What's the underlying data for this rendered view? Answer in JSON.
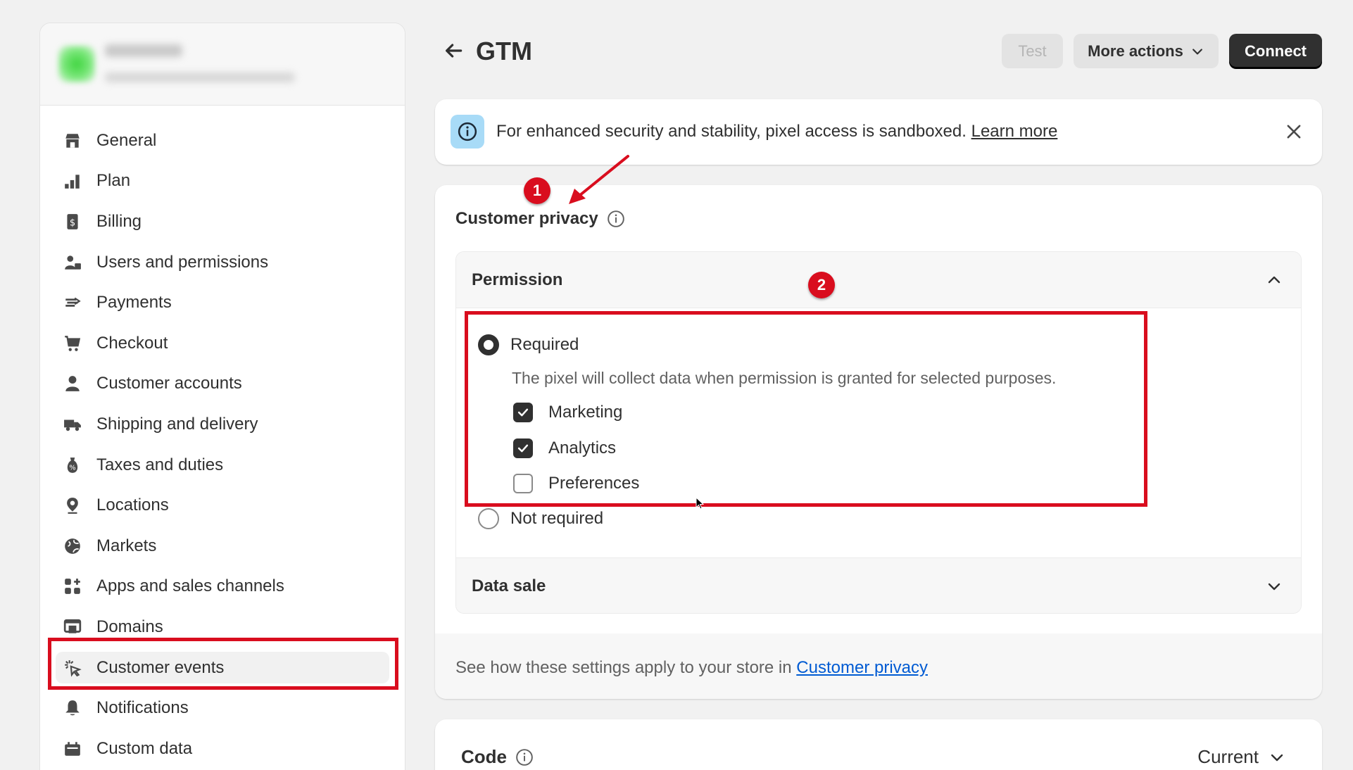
{
  "page": {
    "title": "GTM",
    "buttons": {
      "test": "Test",
      "more_actions": "More actions",
      "connect": "Connect"
    }
  },
  "sidebar": {
    "items": [
      {
        "label": "General",
        "icon": "store-icon"
      },
      {
        "label": "Plan",
        "icon": "plan-icon"
      },
      {
        "label": "Billing",
        "icon": "billing-icon"
      },
      {
        "label": "Users and permissions",
        "icon": "users-icon"
      },
      {
        "label": "Payments",
        "icon": "payments-icon"
      },
      {
        "label": "Checkout",
        "icon": "cart-icon"
      },
      {
        "label": "Customer accounts",
        "icon": "person-icon"
      },
      {
        "label": "Shipping and delivery",
        "icon": "truck-icon"
      },
      {
        "label": "Taxes and duties",
        "icon": "tax-icon"
      },
      {
        "label": "Locations",
        "icon": "location-icon"
      },
      {
        "label": "Markets",
        "icon": "globe-icon"
      },
      {
        "label": "Apps and sales channels",
        "icon": "apps-icon"
      },
      {
        "label": "Domains",
        "icon": "domains-icon"
      },
      {
        "label": "Customer events",
        "icon": "cursor-click-icon",
        "active": true
      },
      {
        "label": "Notifications",
        "icon": "bell-icon"
      },
      {
        "label": "Custom data",
        "icon": "custom-data-icon"
      }
    ]
  },
  "banner": {
    "text": "For enhanced security and stability, pixel access is sandboxed.",
    "link": "Learn more"
  },
  "privacy": {
    "title": "Customer privacy",
    "permission": {
      "title": "Permission",
      "required_label": "Required",
      "required_help": "The pixel will collect data when permission is granted for selected purposes.",
      "purposes": [
        {
          "label": "Marketing",
          "checked": true
        },
        {
          "label": "Analytics",
          "checked": true
        },
        {
          "label": "Preferences",
          "checked": false
        }
      ],
      "not_required_label": "Not required",
      "selected": "Required"
    },
    "data_sale": {
      "title": "Data sale"
    },
    "footer_text": "See how these settings apply to your store in",
    "footer_link": "Customer privacy"
  },
  "code": {
    "title": "Code",
    "version": "Current"
  },
  "annotations": {
    "badge1": "1",
    "badge2": "2"
  },
  "colors": {
    "annotation": "#d90d1e",
    "link": "#005bd3",
    "primary": "#303030",
    "info": "#a8dbf7"
  }
}
